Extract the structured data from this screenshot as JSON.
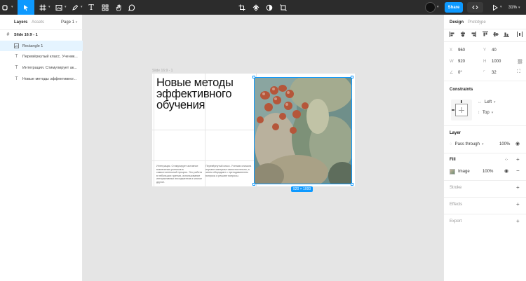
{
  "toolbar": {
    "tools": [
      "main-menu",
      "move",
      "frame",
      "shape",
      "pen",
      "text",
      "resources",
      "hand",
      "comment"
    ],
    "center_tools": [
      "crop",
      "component",
      "mask",
      "transform"
    ],
    "share_label": "Share",
    "zoom_label": "31%"
  },
  "left_panel": {
    "tabs": [
      "Layers",
      "Assets"
    ],
    "page_label": "Page 1",
    "layers": [
      {
        "name": "Slide 16:9 - 1",
        "type": "frame"
      },
      {
        "name": "Rectangle 1",
        "type": "image",
        "selected": true
      },
      {
        "name": "Перевёрнутый класс. Ученик...",
        "type": "text"
      },
      {
        "name": "Интеграция. Стимулирует ак...",
        "type": "text"
      },
      {
        "name": "Новые методы эффективног...",
        "type": "text"
      }
    ]
  },
  "canvas": {
    "frame_label": "Slide 16:9 - 1",
    "headline": "Новые методы эффективного обучения",
    "para_left": "Интеграция. Стимулирует активное вовлечение учеников в самостоятельный процесс. Это работа в небольших группах, использование интерактивных инструментов и многое другое.",
    "para_right": "Перевёрнутый класс. Ученики сначала изучают материал самостоятельно, а затем обсуждают с преподавателем вопросы и решают вопросы.",
    "size_badge": "920 × 1000"
  },
  "right_panel": {
    "tabs": [
      "Design",
      "Prototype"
    ],
    "x": "960",
    "y": "40",
    "w": "920",
    "h": "1000",
    "rotation": "0°",
    "radius": "32",
    "constraints_title": "Constraints",
    "constraint_h": "Left",
    "constraint_v": "Top",
    "layer_title": "Layer",
    "blend_mode": "Pass through",
    "layer_opacity": "100%",
    "fill_title": "Fill",
    "fill_type": "Image",
    "fill_opacity": "100%",
    "stroke_title": "Stroke",
    "effects_title": "Effects",
    "export_title": "Export"
  }
}
